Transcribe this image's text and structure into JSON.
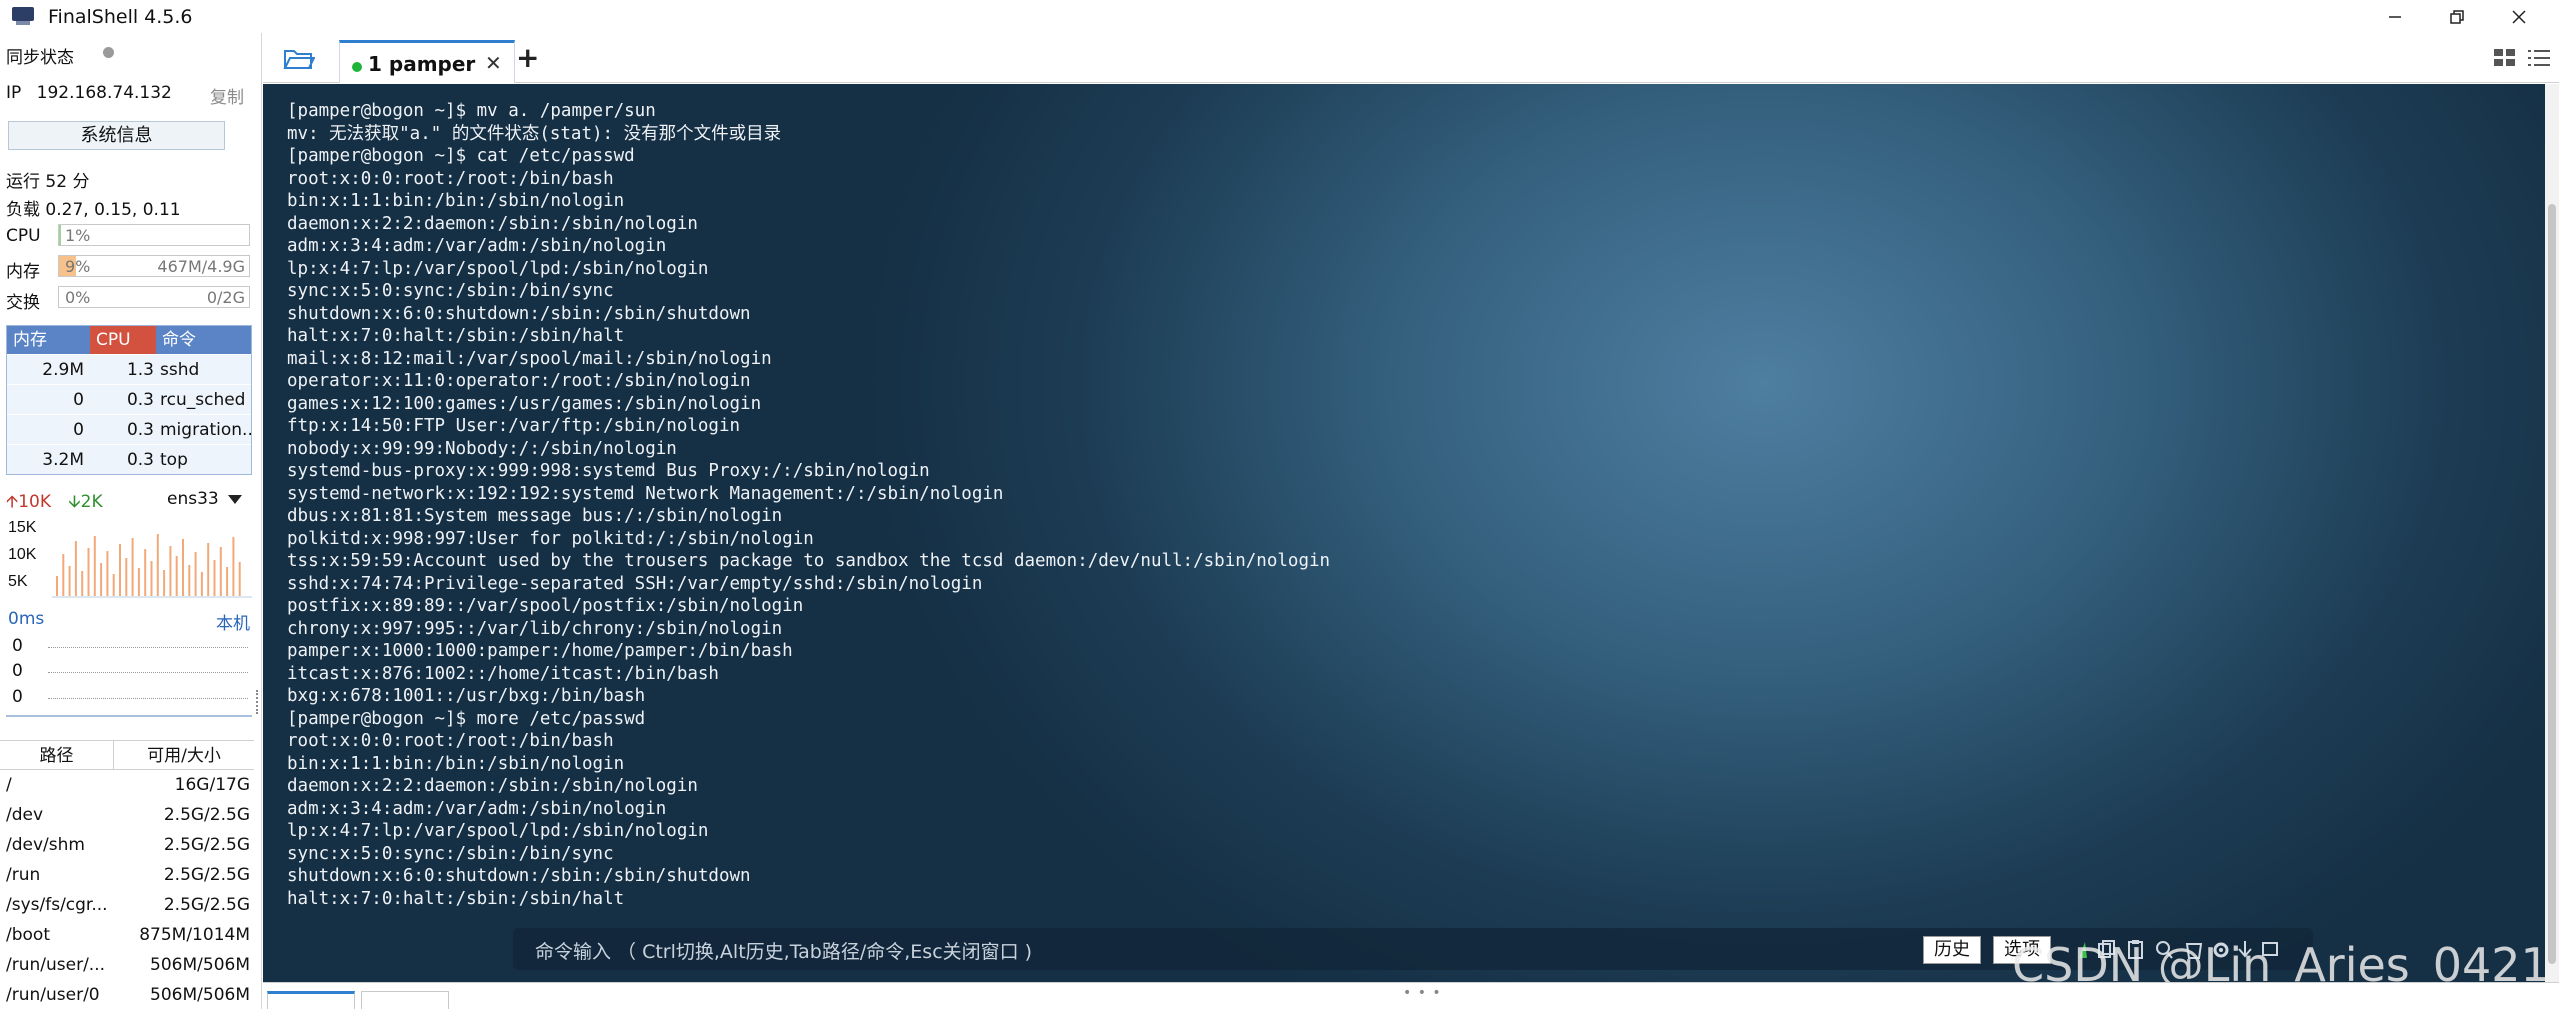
{
  "app": {
    "title": "FinalShell 4.5.6"
  },
  "sidebar": {
    "sync_label": "同步状态",
    "ip_label": "IP",
    "ip_value": "192.168.74.132",
    "copy_label": "复制",
    "sysinfo_button": "系统信息",
    "uptime": "运行 52 分",
    "load": "负载 0.27, 0.15, 0.11",
    "cpu": {
      "label": "CPU",
      "percent_text": "1%",
      "fraction": 0.01
    },
    "mem": {
      "label": "内存",
      "percent_text": "9%",
      "amount": "467M/4.9G",
      "fraction": 0.09
    },
    "swap": {
      "label": "交换",
      "percent_text": "0%",
      "amount": "0/2G",
      "fraction": 0.0
    },
    "proc_table": {
      "headers": [
        "内存",
        "CPU",
        "命令"
      ],
      "rows": [
        {
          "mem": "2.9M",
          "cpu": "1.3",
          "cmd": "sshd"
        },
        {
          "mem": "0",
          "cpu": "0.3",
          "cmd": "rcu_sched"
        },
        {
          "mem": "0",
          "cpu": "0.3",
          "cmd": "migration.."
        },
        {
          "mem": "3.2M",
          "cpu": "0.3",
          "cmd": "top"
        }
      ]
    },
    "net": {
      "up": "10K",
      "down": "2K",
      "interface": "ens33",
      "y_labels": [
        "15K",
        "10K",
        "5K"
      ]
    },
    "latency": {
      "value": "0ms",
      "target": "本机",
      "rows": [
        "0",
        "0",
        "0"
      ]
    },
    "disk_table": {
      "headers": [
        "路径",
        "可用/大小"
      ],
      "rows": [
        {
          "path": "/",
          "size": "16G/17G"
        },
        {
          "path": "/dev",
          "size": "2.5G/2.5G"
        },
        {
          "path": "/dev/shm",
          "size": "2.5G/2.5G"
        },
        {
          "path": "/run",
          "size": "2.5G/2.5G"
        },
        {
          "path": "/sys/fs/cgr...",
          "size": "2.5G/2.5G"
        },
        {
          "path": "/boot",
          "size": "875M/1014M"
        },
        {
          "path": "/run/user/...",
          "size": "506M/506M"
        },
        {
          "path": "/run/user/0",
          "size": "506M/506M"
        }
      ]
    }
  },
  "tabs": [
    {
      "label": "1 pamper",
      "active": true
    }
  ],
  "terminal": {
    "lines": [
      "[pamper@bogon ~]$ mv a. /pamper/sun",
      "mv: 无法获取\"a.\" 的文件状态(stat): 没有那个文件或目录",
      "[pamper@bogon ~]$ cat /etc/passwd",
      "root:x:0:0:root:/root:/bin/bash",
      "bin:x:1:1:bin:/bin:/sbin/nologin",
      "daemon:x:2:2:daemon:/sbin:/sbin/nologin",
      "adm:x:3:4:adm:/var/adm:/sbin/nologin",
      "lp:x:4:7:lp:/var/spool/lpd:/sbin/nologin",
      "sync:x:5:0:sync:/sbin:/bin/sync",
      "shutdown:x:6:0:shutdown:/sbin:/sbin/shutdown",
      "halt:x:7:0:halt:/sbin:/sbin/halt",
      "mail:x:8:12:mail:/var/spool/mail:/sbin/nologin",
      "operator:x:11:0:operator:/root:/sbin/nologin",
      "games:x:12:100:games:/usr/games:/sbin/nologin",
      "ftp:x:14:50:FTP User:/var/ftp:/sbin/nologin",
      "nobody:x:99:99:Nobody:/:/sbin/nologin",
      "systemd-bus-proxy:x:999:998:systemd Bus Proxy:/:/sbin/nologin",
      "systemd-network:x:192:192:systemd Network Management:/:/sbin/nologin",
      "dbus:x:81:81:System message bus:/:/sbin/nologin",
      "polkitd:x:998:997:User for polkitd:/:/sbin/nologin",
      "tss:x:59:59:Account used by the trousers package to sandbox the tcsd daemon:/dev/null:/sbin/nologin",
      "sshd:x:74:74:Privilege-separated SSH:/var/empty/sshd:/sbin/nologin",
      "postfix:x:89:89::/var/spool/postfix:/sbin/nologin",
      "chrony:x:997:995::/var/lib/chrony:/sbin/nologin",
      "pamper:x:1000:1000:pamper:/home/pamper:/bin/bash",
      "itcast:x:876:1002::/home/itcast:/bin/bash",
      "bxg:x:678:1001::/usr/bxg:/bin/bash",
      "[pamper@bogon ~]$ more /etc/passwd",
      "root:x:0:0:root:/root:/bin/bash",
      "bin:x:1:1:bin:/bin:/sbin/nologin",
      "daemon:x:2:2:daemon:/sbin:/sbin/nologin",
      "adm:x:3:4:adm:/var/adm:/sbin/nologin",
      "lp:x:4:7:lp:/var/spool/lpd:/sbin/nologin",
      "sync:x:5:0:sync:/sbin:/bin/sync",
      "shutdown:x:6:0:shutdown:/sbin:/sbin/shutdown",
      "halt:x:7:0:halt:/sbin:/sbin/halt"
    ]
  },
  "command_bar": {
    "hint": "命令输入 （ Ctrl切换,Alt历史,Tab路径/命令,Esc关闭窗口 )",
    "history_button": "历史",
    "options_button": "选项"
  },
  "watermark": "CSDN @Lin_Aries_0421",
  "colors": {
    "tab_active": "#2f7fd0",
    "session_dot": "#1fb53a",
    "proc_header_mem": "#5a84c6",
    "proc_header_cpu": "#d2523f",
    "net_up": "#c0392b",
    "net_down": "#2f8f2f",
    "net_bars": "#f2a97a"
  }
}
